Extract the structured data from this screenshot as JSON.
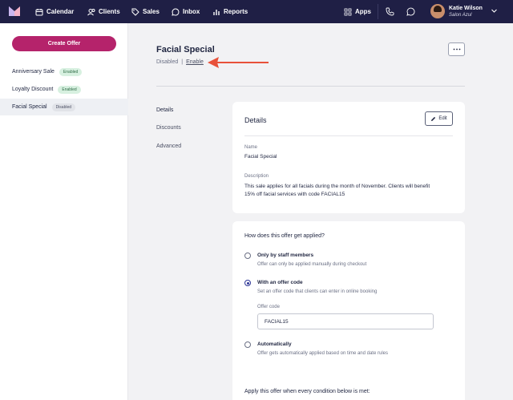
{
  "nav": {
    "items": [
      {
        "label": "Calendar",
        "icon": "calendar-icon"
      },
      {
        "label": "Clients",
        "icon": "clients-icon"
      },
      {
        "label": "Sales",
        "icon": "sales-tag-icon"
      },
      {
        "label": "Inbox",
        "icon": "inbox-chat-icon"
      },
      {
        "label": "Reports",
        "icon": "bar-chart-icon"
      },
      {
        "label": "Apps",
        "icon": "apps-grid-icon"
      }
    ],
    "user": {
      "name": "Katie Wilson",
      "salon": "Salon Azul"
    },
    "accent": "#1f1f45"
  },
  "sidebar": {
    "create_label": "Create Offer",
    "create_color": "#b5236b",
    "offers": [
      {
        "name": "Anniversary Sale",
        "status": "Enabled"
      },
      {
        "name": "Loyalty Discount",
        "status": "Enabled"
      },
      {
        "name": "Facial Special",
        "status": "Disabled"
      }
    ]
  },
  "header": {
    "title": "Facial Special",
    "status": "Disabled",
    "separator": "|",
    "enable_link": "Enable"
  },
  "subnav": [
    "Details",
    "Discounts",
    "Advanced"
  ],
  "details_card": {
    "title": "Details",
    "edit_label": "Edit",
    "name_label": "Name",
    "name_value": "Facial Special",
    "description_label": "Description",
    "description_line1": "This sale applies for all facials during the month of November. Clients will benefit",
    "description_line2": "15% off facial services with code FACIAL15"
  },
  "apply_card": {
    "question": "How does this offer get applied?",
    "options": [
      {
        "title": "Only by staff members",
        "desc": "Offer can only be applied manually during checkout",
        "checked": false
      },
      {
        "title": "With an offer code",
        "desc": "Set an offer code that clients can enter in online booking",
        "checked": true
      },
      {
        "title": "Automatically",
        "desc": "Offer gets automatically applied based on time and date rules",
        "checked": false
      }
    ],
    "code_label": "Offer code",
    "code_value": "FACIAL15"
  },
  "conditions_card": {
    "text": "Apply this offer when every condition below is met:"
  }
}
